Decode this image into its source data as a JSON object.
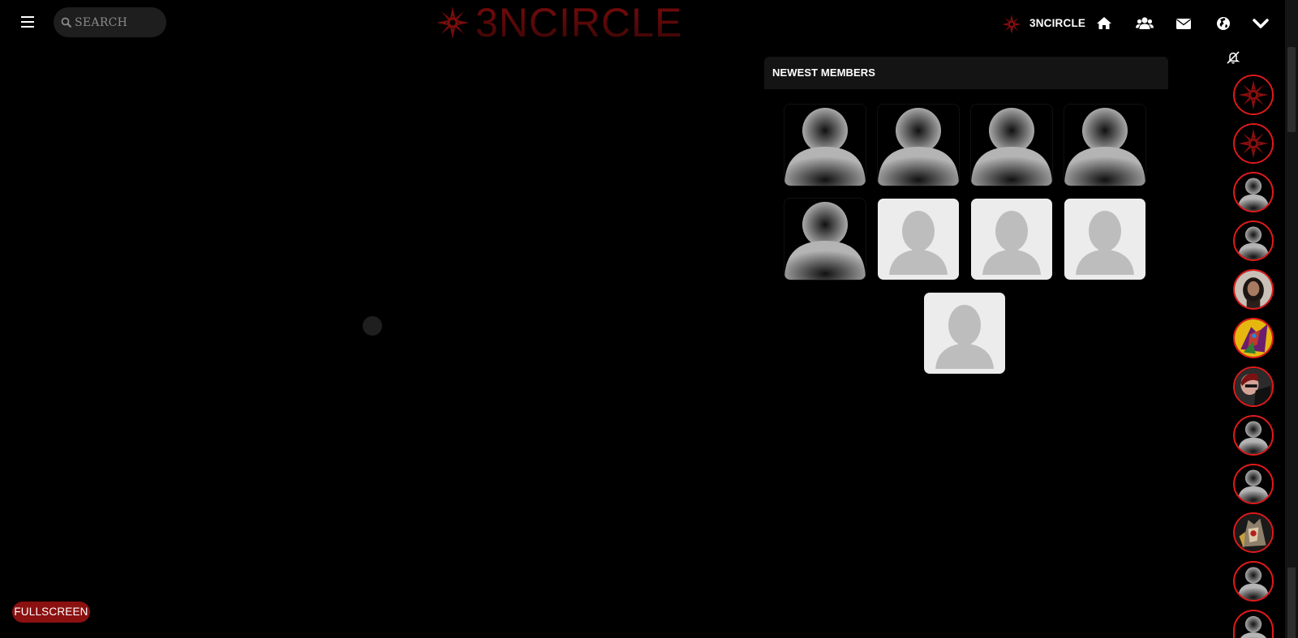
{
  "header": {
    "search_placeholder": "SEARCH",
    "logo_text": "3NCIRCLE",
    "brand_label": "3NCIRCLE",
    "nav_icons": [
      "home-icon",
      "users-icon",
      "envelope-icon",
      "globe-icon",
      "chevron-down-icon"
    ]
  },
  "newest_members": {
    "title": "NEWEST MEMBERS",
    "tiles": [
      "dark-default-avatar",
      "dark-default-avatar",
      "dark-default-avatar",
      "dark-default-avatar",
      "dark-default-avatar",
      "light-default-avatar",
      "light-default-avatar",
      "light-default-avatar",
      "light-default-avatar"
    ]
  },
  "online_strip": {
    "mute_icon": "bell-slash-icon",
    "avatars": [
      "emblem",
      "emblem",
      "default",
      "default",
      "photo-man",
      "photo-colorful",
      "photo-person",
      "default",
      "default",
      "photo-armor",
      "default",
      "default"
    ]
  },
  "fullscreen_label": "FULLSCREEN",
  "colors": {
    "accent_red": "#e11a1a",
    "button_red": "#8b1010",
    "logo_red": "#6b0b0b"
  }
}
